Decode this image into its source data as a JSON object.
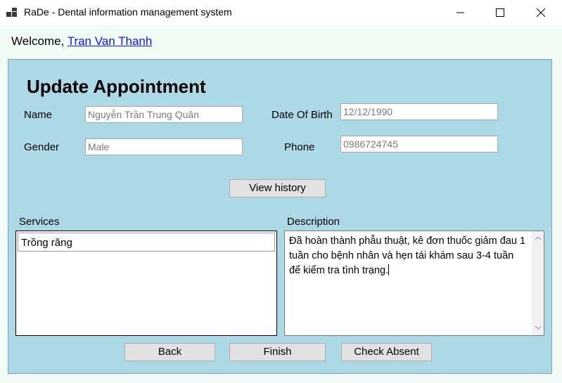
{
  "window": {
    "title": "RaDe - Dental information management system",
    "icon": "app-grid-icon"
  },
  "welcome": {
    "prefix": "Welcome,",
    "user_name": "Tran Van Thanh"
  },
  "form": {
    "heading": "Update Appointment",
    "name_label": "Name",
    "name_value": "Nguyễn Trần Trung Quân",
    "dob_label": "Date Of Birth",
    "dob_value": "12/12/1990",
    "gender_label": "Gender",
    "gender_value": "Male",
    "phone_label": "Phone",
    "phone_value": "0986724745",
    "view_history_label": "View history",
    "services_label": "Services",
    "services": [
      "Trồng răng"
    ],
    "description_label": "Description",
    "description_value": "Đã hoàn thành phẫu thuật, kê đơn thuốc giảm đau 1 tuần cho bệnh nhân và hẹn tái khám sau 3-4 tuần để kiểm tra tình trạng."
  },
  "actions": {
    "back_label": "Back",
    "finish_label": "Finish",
    "check_absent_label": "Check Absent"
  },
  "colors": {
    "panel_bg": "#add8e6",
    "link": "#0b1ad6",
    "page_bg": "#f3fbf6"
  }
}
